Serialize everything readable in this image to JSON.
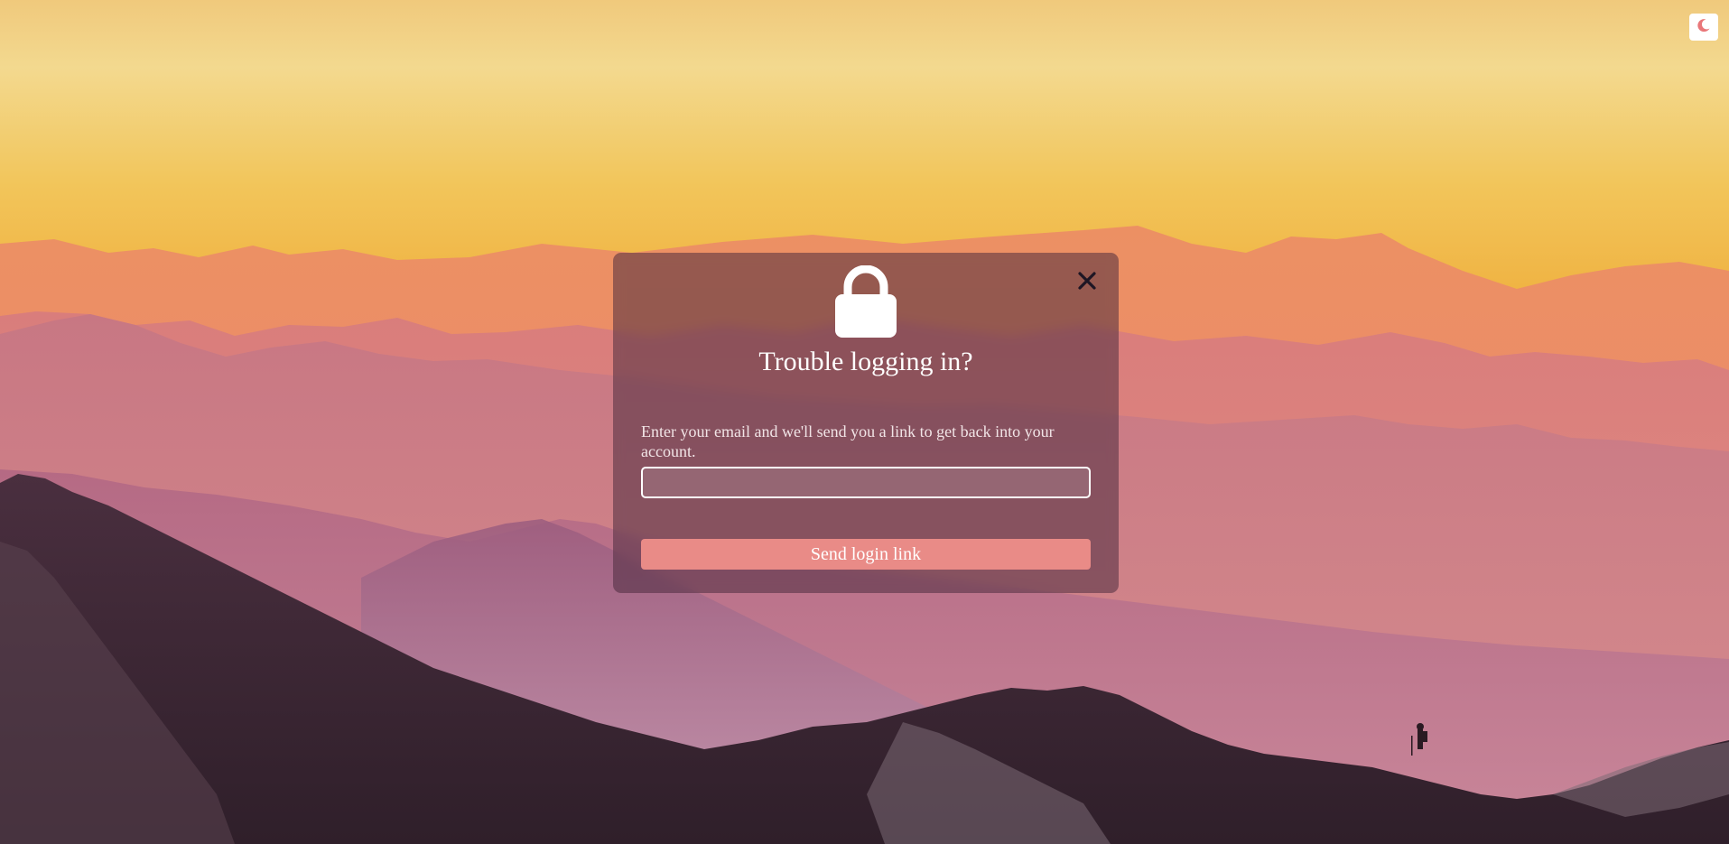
{
  "theme_toggle": {
    "icon": "moon-icon",
    "icon_color": "#e9777a"
  },
  "modal": {
    "close_icon": "close-icon",
    "lock_icon": "lock-icon",
    "title": "Trouble logging in?",
    "description": "Enter your email and we'll send you a link to get back into your account.",
    "email_input": {
      "value": "",
      "placeholder": ""
    },
    "submit_label": "Send login link"
  },
  "colors": {
    "accent": "#e98b87",
    "panel": "rgba(70,40,60,0.52)",
    "sky_top": "#f3d58a",
    "sky_mid": "#f0b445"
  }
}
